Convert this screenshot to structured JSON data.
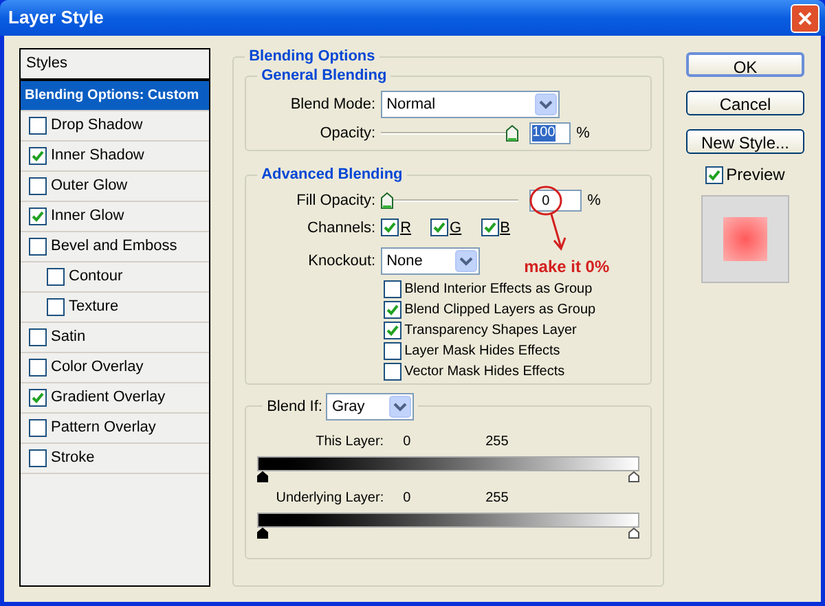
{
  "window": {
    "title": "Layer Style"
  },
  "sidebar": {
    "header": "Styles",
    "items": [
      {
        "label": "Blending Options: Custom",
        "kind": "heading",
        "selected": true
      },
      {
        "label": "Drop Shadow",
        "kind": "check",
        "checked": false,
        "selected": false
      },
      {
        "label": "Inner Shadow",
        "kind": "check",
        "checked": true,
        "selected": false
      },
      {
        "label": "Outer Glow",
        "kind": "check",
        "checked": false,
        "selected": false
      },
      {
        "label": "Inner Glow",
        "kind": "check",
        "checked": true,
        "selected": false
      },
      {
        "label": "Bevel and Emboss",
        "kind": "check",
        "checked": false,
        "selected": false,
        "children": [
          {
            "label": "Contour",
            "kind": "check",
            "checked": false,
            "selected": false
          },
          {
            "label": "Texture",
            "kind": "check",
            "checked": false,
            "selected": false
          }
        ]
      },
      {
        "label": "Satin",
        "kind": "check",
        "checked": false,
        "selected": false
      },
      {
        "label": "Color Overlay",
        "kind": "check",
        "checked": false,
        "selected": false
      },
      {
        "label": "Gradient Overlay",
        "kind": "check",
        "checked": true,
        "selected": false
      },
      {
        "label": "Pattern Overlay",
        "kind": "check",
        "checked": false,
        "selected": false
      },
      {
        "label": "Stroke",
        "kind": "check",
        "checked": false,
        "selected": false
      }
    ]
  },
  "blending_options": {
    "title": "Blending Options",
    "general": {
      "title": "General Blending",
      "blend_mode": {
        "label": "Blend Mode:",
        "value": "Normal"
      },
      "opacity": {
        "label": "Opacity:",
        "level": 1,
        "value": "100",
        "unit": "%"
      }
    },
    "advanced": {
      "title": "Advanced Blending",
      "fill_opacity": {
        "label": "Fill Opacity:",
        "level": 0,
        "value": "0",
        "unit": "%"
      },
      "channels": {
        "label": "Channels:",
        "items": [
          {
            "label": "R",
            "checked": true
          },
          {
            "label": "G",
            "checked": true
          },
          {
            "label": "B",
            "checked": true
          }
        ]
      },
      "knockout": {
        "label": "Knockout:",
        "value": "None"
      },
      "annotation": "make it 0%",
      "options": [
        {
          "label": "Blend Interior Effects as Group",
          "checked": false
        },
        {
          "label": "Blend Clipped Layers as Group",
          "checked": true
        },
        {
          "label": "Transparency Shapes Layer",
          "checked": true
        },
        {
          "label": "Layer Mask Hides Effects",
          "checked": false
        },
        {
          "label": "Vector Mask Hides Effects",
          "checked": false
        }
      ]
    },
    "blend_if": {
      "label": "Blend If:",
      "value": "Gray",
      "layers": [
        {
          "label": "This Layer:",
          "low": "0",
          "high": "255"
        },
        {
          "label": "Underlying Layer:",
          "low": "0",
          "high": "255"
        }
      ]
    }
  },
  "buttons": [
    {
      "label": "OK",
      "default": true
    },
    {
      "label": "Cancel",
      "default": false
    },
    {
      "label": "New Style...",
      "default": false
    }
  ],
  "preview": {
    "label": "Preview",
    "checked": true
  }
}
